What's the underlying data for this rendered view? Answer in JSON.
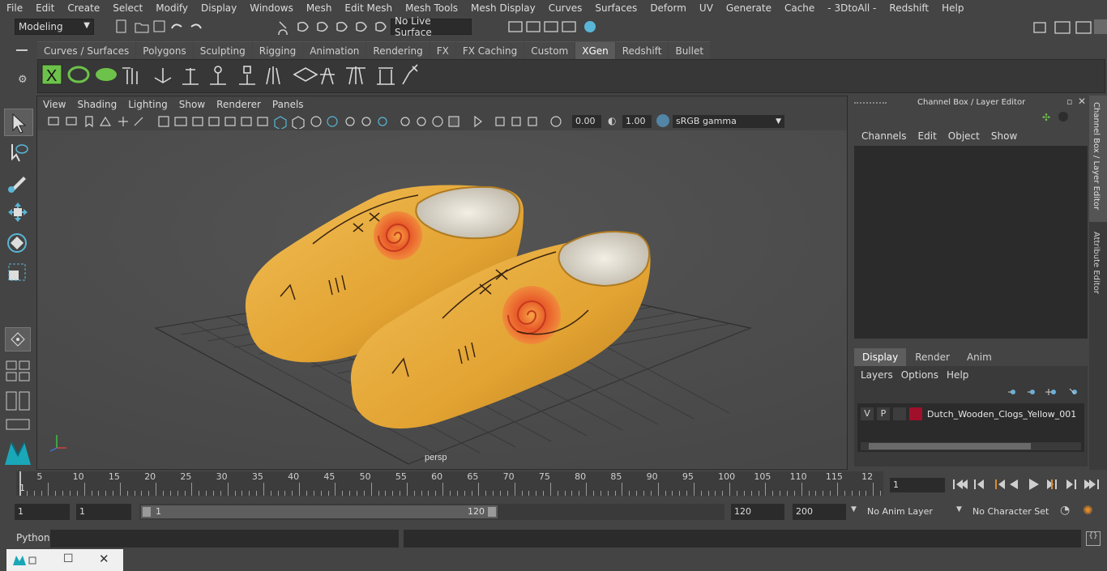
{
  "menubar": [
    "File",
    "Edit",
    "Create",
    "Select",
    "Modify",
    "Display",
    "Windows",
    "Mesh",
    "Edit Mesh",
    "Mesh Tools",
    "Mesh Display",
    "Curves",
    "Surfaces",
    "Deform",
    "UV",
    "Generate",
    "Cache",
    "- 3DtoAll -",
    "Redshift",
    "Help"
  ],
  "status": {
    "mode": "Modeling",
    "live_surface": "No Live Surface"
  },
  "shelf_tabs": [
    "Curves / Surfaces",
    "Polygons",
    "Sculpting",
    "Rigging",
    "Animation",
    "Rendering",
    "FX",
    "FX Caching",
    "Custom",
    "XGen",
    "Redshift",
    "Bullet"
  ],
  "shelf_active": "XGen",
  "viewport": {
    "menu": [
      "View",
      "Shading",
      "Lighting",
      "Show",
      "Renderer",
      "Panels"
    ],
    "exposure": "0.00",
    "gamma": "1.00",
    "color_space": "sRGB gamma",
    "camera_label": "persp"
  },
  "channel_box": {
    "title": "Channel Box / Layer Editor",
    "menu": [
      "Channels",
      "Edit",
      "Object",
      "Show"
    ],
    "layer_tabs": [
      "Display",
      "Render",
      "Anim"
    ],
    "layer_tab_active": "Display",
    "layer_menu": [
      "Layers",
      "Options",
      "Help"
    ],
    "layer": {
      "v": "V",
      "p": "P",
      "name": "Dutch_Wooden_Clogs_Yellow_001",
      "color": "#a0102a"
    }
  },
  "side_tabs": [
    "Channel Box / Layer Editor",
    "Attribute Editor"
  ],
  "timeline": {
    "ticks": [
      "5",
      "10",
      "15",
      "20",
      "25",
      "30",
      "35",
      "40",
      "45",
      "50",
      "55",
      "60",
      "65",
      "70",
      "75",
      "80",
      "85",
      "90",
      "95",
      "100",
      "105",
      "110",
      "115",
      "12"
    ],
    "start_marker": "1",
    "current_frame": "1"
  },
  "range": {
    "start": "1",
    "anim_start": "1",
    "slider_start": "1",
    "slider_end": "120",
    "end": "120",
    "anim_end": "200",
    "anim_layer": "No Anim Layer",
    "character_set": "No Character Set"
  },
  "command": {
    "language": "Python"
  },
  "colors": {
    "clog": "#e9a93a",
    "accent": "#5285a6",
    "layer_red": "#a0102a"
  }
}
